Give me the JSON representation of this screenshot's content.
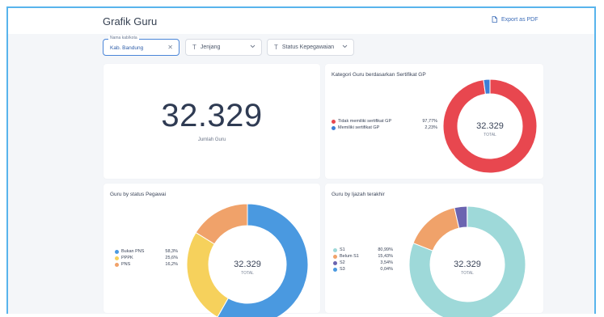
{
  "header": {
    "title": "Grafik Guru",
    "export_label": "Export as PDF"
  },
  "filters": {
    "region": {
      "label": "Nama kab/kota",
      "value": "Kab. Bandung"
    },
    "level": {
      "label": "Jenjang"
    },
    "employment": {
      "label": "Status Kepegawaian"
    }
  },
  "total_card": {
    "value": "32.329",
    "caption": "Jumlah Guru"
  },
  "cert_card": {
    "title": "Kategori Guru berdasarkan Sertifikat GP",
    "center_value": "32.329",
    "center_label": "TOTAL",
    "items": [
      {
        "label": "Tidak memiliki sertifikat GP",
        "percent": "97,77%",
        "share": 97.77,
        "color": "#e8474f"
      },
      {
        "label": "Memiliki sertifikat GP",
        "percent": "2,23%",
        "share": 2.23,
        "color": "#3e7fd6"
      }
    ]
  },
  "status_card": {
    "title": "Guru by status Pegawai",
    "center_value": "32.329",
    "center_label": "TOTAL",
    "items": [
      {
        "label": "Bukan PNS",
        "percent": "58,3%",
        "share": 58.3,
        "color": "#4a99e0"
      },
      {
        "label": "PPPK",
        "percent": "25,6%",
        "share": 25.6,
        "color": "#f6d15c"
      },
      {
        "label": "PNS",
        "percent": "16,2%",
        "share": 16.2,
        "color": "#f0a26a"
      }
    ]
  },
  "education_card": {
    "title": "Guru by Ijazah terakhir",
    "center_value": "32.329",
    "center_label": "TOTAL",
    "items": [
      {
        "label": "S1",
        "percent": "80,99%",
        "share": 80.99,
        "color": "#9ed9d9"
      },
      {
        "label": "Belum S1",
        "percent": "15,43%",
        "share": 15.43,
        "color": "#f0a26a"
      },
      {
        "label": "S2",
        "percent": "3,54%",
        "share": 3.54,
        "color": "#6b64b0"
      },
      {
        "label": "S3",
        "percent": "0,04%",
        "share": 0.04,
        "color": "#4a99e0"
      }
    ]
  }
}
